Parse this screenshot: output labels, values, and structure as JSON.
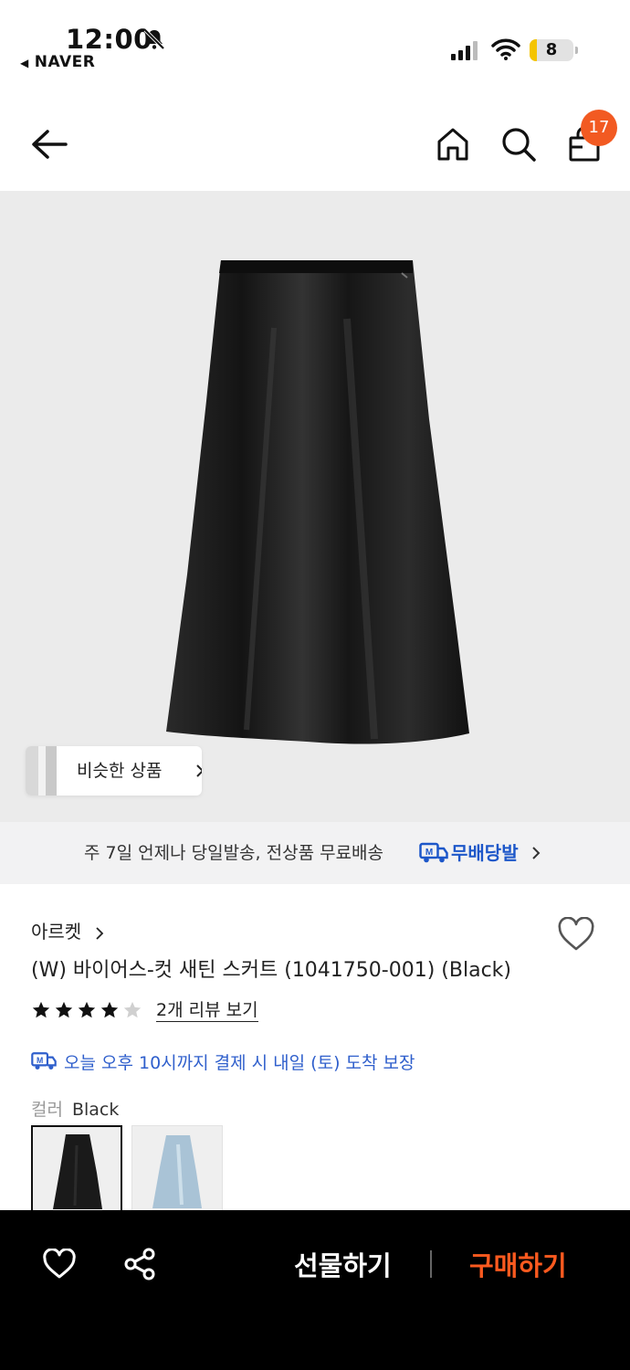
{
  "status_bar": {
    "time": "12:00",
    "back_app": "NAVER",
    "battery": "8"
  },
  "nav": {
    "cart_count": "17",
    "icons": [
      "back-arrow-icon",
      "home-icon",
      "search-icon",
      "shopping-bag-icon"
    ]
  },
  "hero": {
    "similar_label": "비슷한 상품"
  },
  "delivery_banner": {
    "text": "주 7일 언제나 당일발송, 전상품 무료배송",
    "brand": "무배당발",
    "brand_color": "#1d57c9"
  },
  "product": {
    "brand": "아르켓",
    "title": "(W) 바이어스-컷 새틴 스커트 (1041750-001) (Black)",
    "rating": 4,
    "rating_max": 5,
    "reviews_link": "2개 리뷰 보기",
    "arrival_notice": "오늘 오후 10시까지 결제 시 내일 (토) 도착 보장",
    "color_label": "컬러",
    "color_value": "Black",
    "swatches": [
      "Black",
      "Light Blue"
    ]
  },
  "bottom_bar": {
    "gift_label": "선물하기",
    "buy_label": "구매하기",
    "buy_color": "#ff5a1f"
  }
}
